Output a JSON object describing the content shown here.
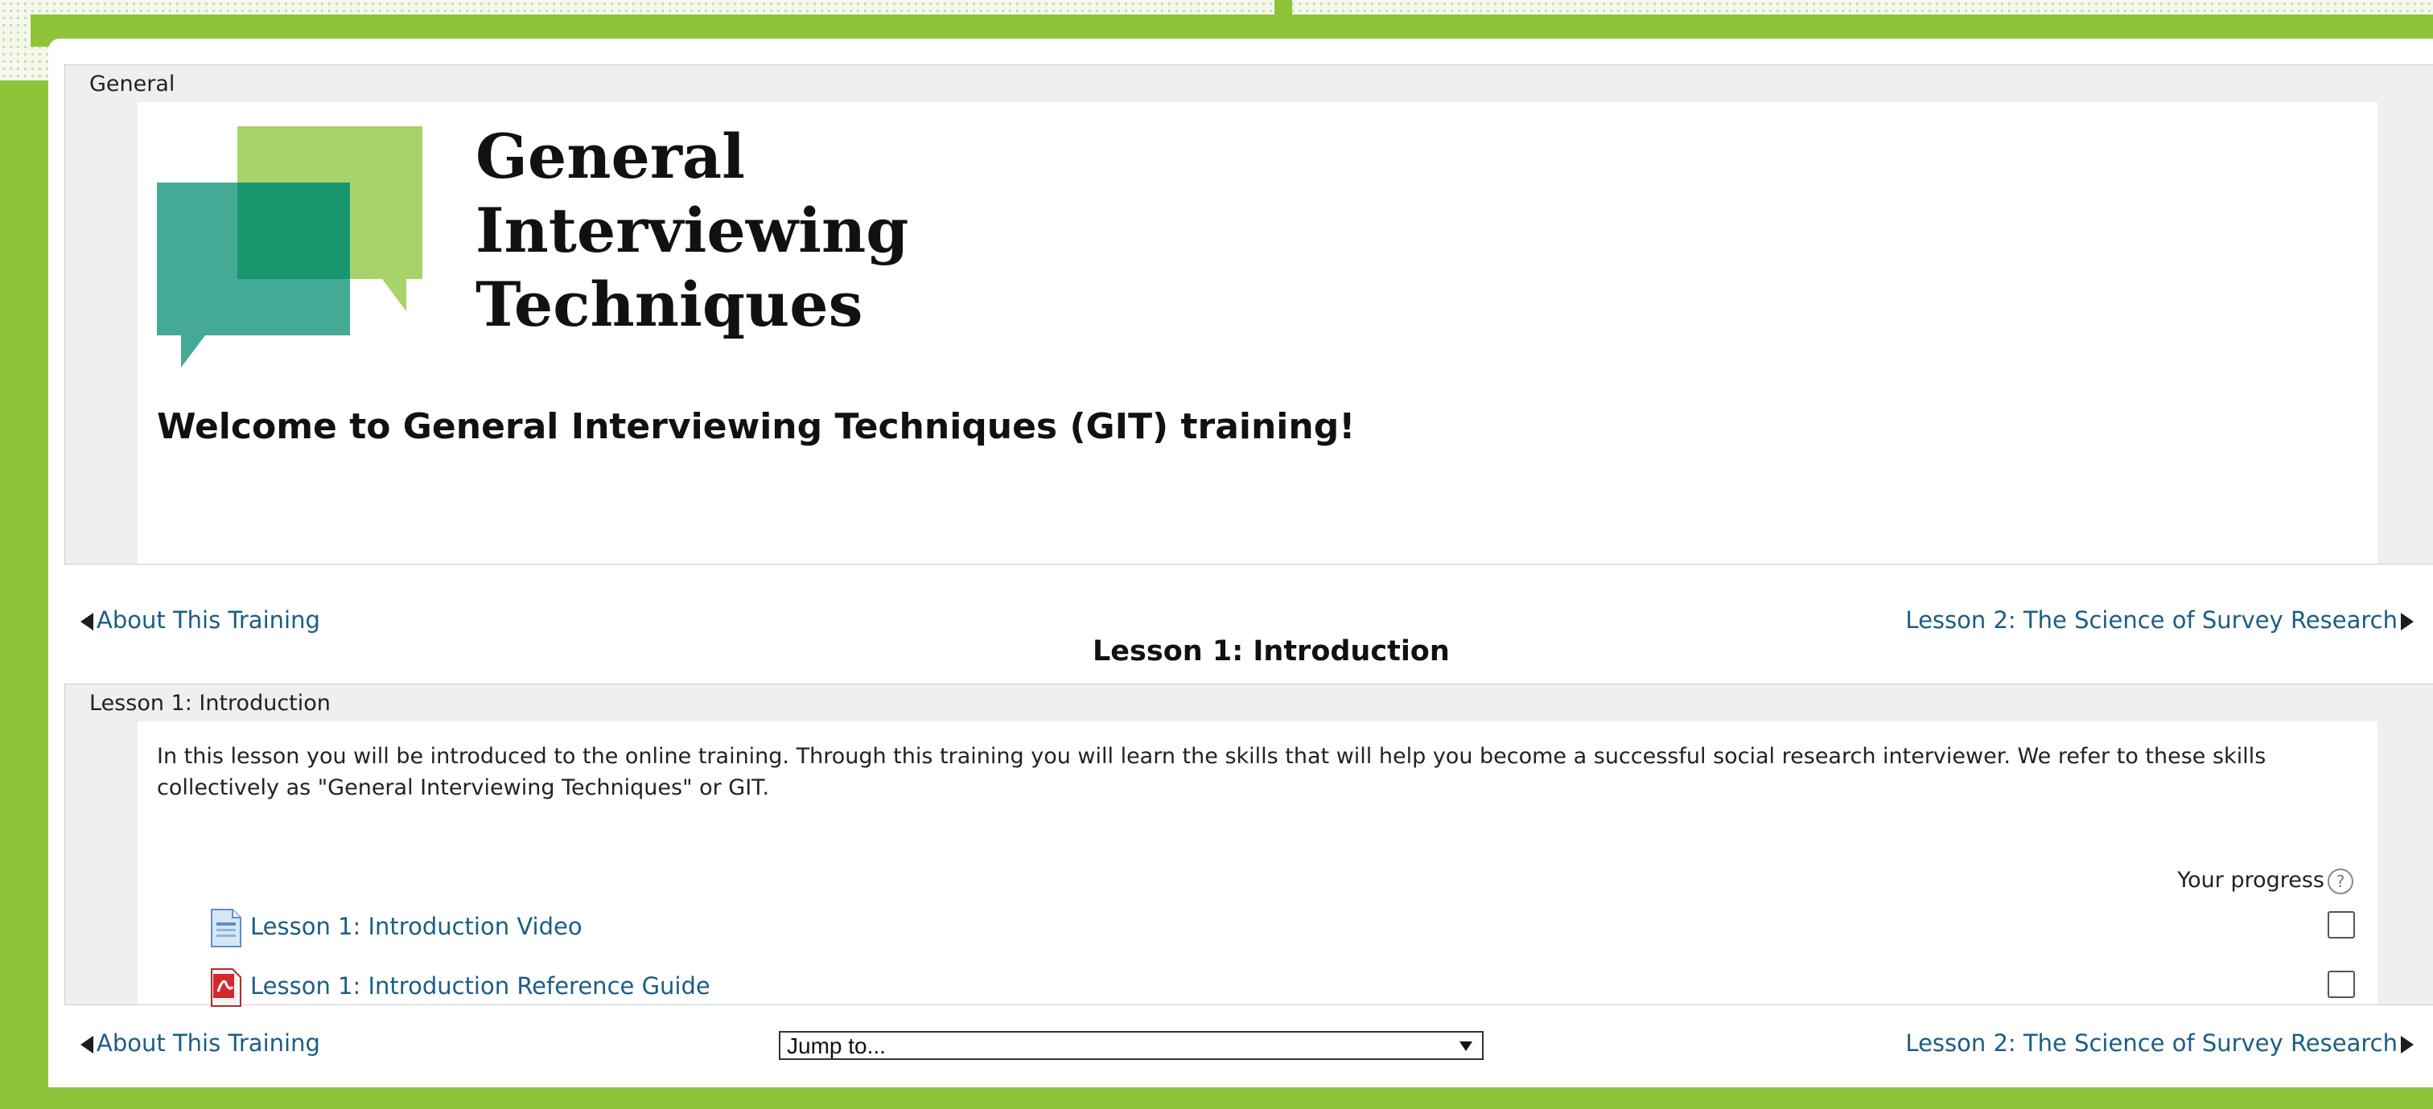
{
  "theme": {
    "frame_green": "#8fc43a",
    "link_color": "#1a5e86",
    "section_bg": "#efefef"
  },
  "general_section": {
    "label": "General",
    "logo": {
      "title_lines": [
        "General",
        "Interviewing",
        "Techniques"
      ],
      "icon": "speech-bubbles-logo"
    },
    "welcome": "Welcome to General Interviewing Techniques (GIT) training!"
  },
  "navigation": {
    "prev_label": "About This Training",
    "next_label": "Lesson 2: The Science of Survey Research",
    "current_heading": "Lesson 1: Introduction"
  },
  "lesson_section": {
    "label": "Lesson 1: Introduction",
    "description": "In this lesson you will be introduced to the online training.  Through this training you will learn the skills that will help you become a successful social research interviewer.  We refer to these skills collectively as \"General Interviewing Techniques\" or GIT.",
    "progress_label": "Your progress",
    "activities": [
      {
        "label": "Lesson 1: Introduction Video",
        "icon": "document-icon",
        "completed": false
      },
      {
        "label": "Lesson 1: Introduction Reference Guide",
        "icon": "pdf-icon",
        "completed": false
      }
    ]
  },
  "jump_to": {
    "selected": "Jump to..."
  }
}
